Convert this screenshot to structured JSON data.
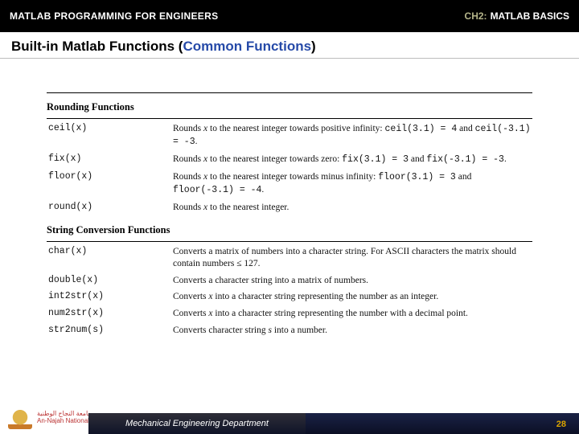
{
  "header": {
    "left": "MATLAB PROGRAMMING FOR ENGINEERS",
    "right_ch": "CH2:",
    "right_txt": "MATLAB BASICS"
  },
  "title": {
    "prefix": "Built-in Matlab Functions ",
    "paren_open": "(",
    "highlight": "Common Functions",
    "paren_close": ")"
  },
  "sections": [
    {
      "heading": "Rounding Functions",
      "rows": [
        {
          "fn": "ceil(x)",
          "desc_html": "Rounds <span class='ital'>x</span> to the nearest integer towards positive infinity: <span class='mono'>ceil(3.1) = 4</span> and <span class='mono'>ceil(-3.1) = -3</span>."
        },
        {
          "fn": "fix(x)",
          "desc_html": "Rounds <span class='ital'>x</span> to the nearest integer towards zero: <span class='mono'>fix(3.1) = 3</span> and <span class='mono'>fix(-3.1) = -3</span>."
        },
        {
          "fn": "floor(x)",
          "desc_html": "Rounds <span class='ital'>x</span> to the nearest integer towards minus infinity: <span class='mono'>floor(3.1) = 3</span> and <span class='mono'>floor(-3.1) = -4</span>."
        },
        {
          "fn": "round(x)",
          "desc_html": "Rounds <span class='ital'>x</span> to the nearest integer."
        }
      ]
    },
    {
      "heading": "String Conversion Functions",
      "rows": [
        {
          "fn": "char(x)",
          "desc_html": "Converts a matrix of numbers into a character string. For ASCII characters the matrix should contain numbers ≤ 127."
        },
        {
          "fn": "double(x)",
          "desc_html": "Converts a character string into a matrix of numbers."
        },
        {
          "fn": "int2str(x)",
          "desc_html": "Converts <span class='ital'>x</span> into a character string representing the number as an integer."
        },
        {
          "fn": "num2str(x)",
          "desc_html": "Converts <span class='ital'>x</span> into a character string representing the number with a decimal point."
        },
        {
          "fn": "str2num(s)",
          "desc_html": "Converts character string <span class='ital'>s</span> into a number."
        }
      ]
    }
  ],
  "footer": {
    "uni_ar": "جامعة النجاح الوطنية",
    "uni_en": "An-Najah National University",
    "dept": "Mechanical Engineering Department",
    "page": "28"
  }
}
